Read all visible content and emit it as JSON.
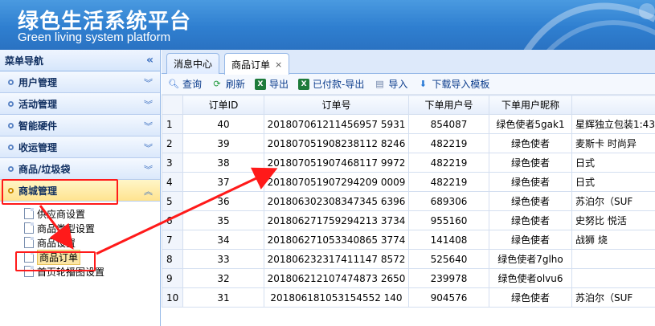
{
  "header": {
    "title_cn": "绿色生活系统平台",
    "title_en": "Green living system platform"
  },
  "sidebar": {
    "title": "菜单导航",
    "collapse_icon": "double-chevron-left-icon",
    "sections": [
      {
        "label": "用户管理"
      },
      {
        "label": "活动管理"
      },
      {
        "label": "智能硬件"
      },
      {
        "label": "收运管理"
      },
      {
        "label": "商品/垃圾袋"
      },
      {
        "label": "商城管理"
      }
    ],
    "sub_items": [
      {
        "label": "供应商设置"
      },
      {
        "label": "商品类型设置"
      },
      {
        "label": "商品设置"
      },
      {
        "label": "商品订单"
      },
      {
        "label": "首页轮播图设置"
      }
    ]
  },
  "tabs": [
    {
      "label": "消息中心"
    },
    {
      "label": "商品订单",
      "close": "×"
    }
  ],
  "toolbar": {
    "query": "查询",
    "refresh": "刷新",
    "export": "导出",
    "paid_export": "已付款-导出",
    "import": "导入",
    "download_template": "下载导入模板"
  },
  "table": {
    "columns": [
      "",
      "订单ID",
      "订单号",
      "下单用户号",
      "下单用户昵称",
      ""
    ],
    "rows": [
      {
        "n": "1",
        "id": "40",
        "no": "201807061211456957 5931",
        "user": "854087",
        "nick": "绿色使者5gak1",
        "extra": "星辉独立包装1:43况"
      },
      {
        "n": "2",
        "id": "39",
        "no": "201807051908238112 8246",
        "user": "482219",
        "nick": "绿色使者",
        "extra": "麦斯卡 时尚异"
      },
      {
        "n": "3",
        "id": "38",
        "no": "201807051907468117 9972",
        "user": "482219",
        "nick": "绿色使者",
        "extra": "日式"
      },
      {
        "n": "4",
        "id": "37",
        "no": "201807051907294209 0009",
        "user": "482219",
        "nick": "绿色使者",
        "extra": "日式"
      },
      {
        "n": "5",
        "id": "36",
        "no": "201806302308347345 6396",
        "user": "689306",
        "nick": "绿色使者",
        "extra": "苏泊尔（SUF"
      },
      {
        "n": "6",
        "id": "35",
        "no": "201806271759294213 3734",
        "user": "955160",
        "nick": "绿色使者",
        "extra": "史努比 悦活"
      },
      {
        "n": "7",
        "id": "34",
        "no": "201806271053340865 3774",
        "user": "141408",
        "nick": "绿色使者",
        "extra": "战狮 烧"
      },
      {
        "n": "8",
        "id": "33",
        "no": "201806232317411147 8572",
        "user": "525640",
        "nick": "绿色使者7glho",
        "extra": ""
      },
      {
        "n": "9",
        "id": "32",
        "no": "201806212107474873 2650",
        "user": "239978",
        "nick": "绿色使者olvu6",
        "extra": ""
      },
      {
        "n": "10",
        "id": "31",
        "no": "201806181053154552 140",
        "user": "904576",
        "nick": "绿色使者",
        "extra": "苏泊尔（SUF"
      }
    ]
  },
  "colors": {
    "header_blue": "#2f7fd0",
    "highlight_red": "#ff1a1a",
    "active_yellow": "#ffe38f"
  }
}
